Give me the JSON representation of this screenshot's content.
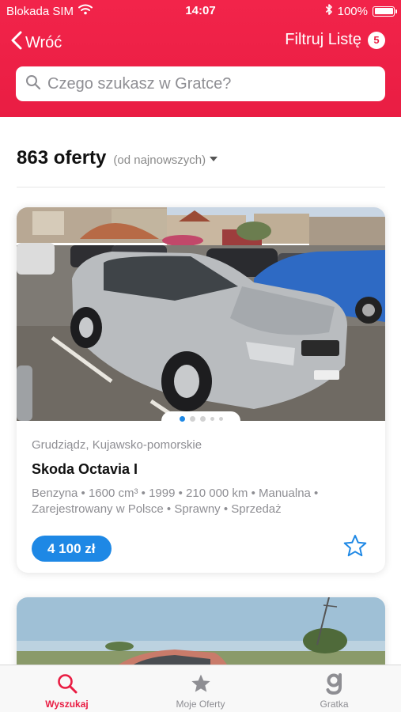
{
  "status_bar": {
    "carrier": "Blokada SIM",
    "time": "14:07",
    "battery": "100%"
  },
  "nav": {
    "back_label": "Wróć",
    "filter_label": "Filtruj Listę",
    "filter_count": "5"
  },
  "search": {
    "placeholder": "Czego szukasz w Gratce?",
    "value": ""
  },
  "results": {
    "count": "863 oferty",
    "sort": "(od najnowszych)"
  },
  "listings": [
    {
      "location": "Grudziądz, Kujawsko-pomorskie",
      "title": "Skoda Octavia I",
      "specs": "Benzyna • 1600 cm³ • 1999 • 210 000 km • Manualna • Zarejestrowany w Polsce • Sprawny • Sprzedaż",
      "price": "4 100 zł",
      "photo_count": 5,
      "active_photo": 1,
      "favorited": false
    }
  ],
  "tabs": [
    {
      "label": "Wyszukaj",
      "icon": "search-icon",
      "active": true
    },
    {
      "label": "Moje Oferty",
      "icon": "star-icon",
      "active": false
    },
    {
      "label": "Gratka",
      "icon": "gratka-logo-icon",
      "active": false
    }
  ],
  "colors": {
    "brand_red": "#e91d43",
    "accent_blue": "#1e88e5",
    "muted_text": "#8e8e93"
  }
}
